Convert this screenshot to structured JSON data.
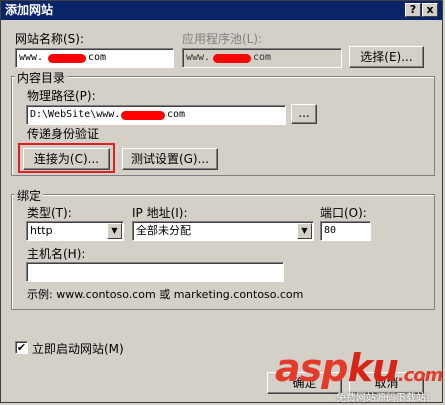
{
  "window": {
    "title": "添加网站",
    "help_label": "?",
    "close_label": "x"
  },
  "site": {
    "name_label": "网站名称(S):",
    "name_value": "www.",
    "name_suffix": "com",
    "pool_label": "应用程序池(L):",
    "pool_value": "www.",
    "pool_suffix": "com",
    "select_button": "选择(E)..."
  },
  "content": {
    "group_label": "内容目录",
    "path_label": "物理路径(P):",
    "path_value": "D:\\WebSite\\www.",
    "path_suffix": "com",
    "browse_button": "...",
    "auth_label": "传递身份验证",
    "connect_button": "连接为(C)...",
    "test_button": "测试设置(G)..."
  },
  "binding": {
    "group_label": "绑定",
    "type_label": "类型(T):",
    "type_value": "http",
    "ip_label": "IP 地址(I):",
    "ip_value": "全部未分配",
    "port_label": "端口(O):",
    "port_value": "80",
    "host_label": "主机名(H):",
    "host_value": "",
    "example": "示例: www.contoso.com 或 marketing.contoso.com"
  },
  "start": {
    "label": "立即启动网站(M)",
    "checked": "✔"
  },
  "footer": {
    "ok_button": "确定",
    "cancel_button": "取消"
  },
  "watermark": {
    "logo_a": "asp",
    "logo_b": "ku",
    "logo_c": ".com",
    "tagline": "免费网站源码下载站!"
  },
  "colors": {
    "titlebar": "#0a246a",
    "face": "#d4d0c8",
    "highlight": "#e02020",
    "watermark": "#e23b2a"
  }
}
